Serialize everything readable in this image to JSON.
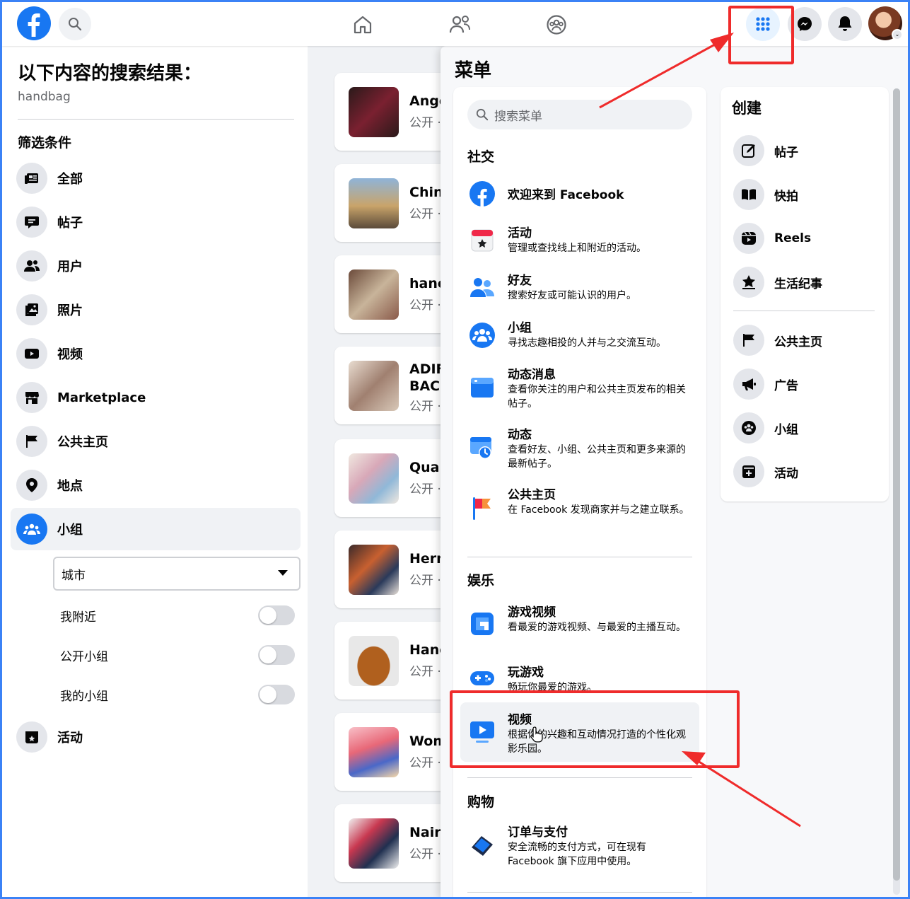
{
  "topbar": {
    "logo": "facebook-logo",
    "icons": [
      "home-icon",
      "friends-icon",
      "groups-icon"
    ],
    "right_icons": [
      "menu-grid-icon",
      "messenger-icon",
      "notification-bell-icon"
    ]
  },
  "sidebar": {
    "title": "以下内容的搜索结果：",
    "query": "handbag",
    "filters_heading": "筛选条件",
    "items": [
      {
        "label": "全部",
        "icon": "all-results-icon"
      },
      {
        "label": "帖子",
        "icon": "posts-icon"
      },
      {
        "label": "用户",
        "icon": "people-icon"
      },
      {
        "label": "照片",
        "icon": "photos-icon"
      },
      {
        "label": "视频",
        "icon": "video-icon"
      },
      {
        "label": "Marketplace",
        "icon": "marketplace-icon"
      },
      {
        "label": "公共主页",
        "icon": "flag-icon"
      },
      {
        "label": "地点",
        "icon": "location-icon"
      },
      {
        "label": "小组",
        "icon": "groups-icon"
      }
    ],
    "city_select": {
      "value": "城市"
    },
    "toggles": [
      {
        "label": "我附近",
        "on": false
      },
      {
        "label": "公开小组",
        "on": false
      },
      {
        "label": "我的小组",
        "on": false
      }
    ],
    "events": {
      "label": "活动",
      "icon": "calendar-icon"
    }
  },
  "results": [
    {
      "title": "Ange",
      "sub": "公开 ·"
    },
    {
      "title": "Chin",
      "sub": "公开 ·"
    },
    {
      "title": "hanc",
      "sub": "公开 ·"
    },
    {
      "title": "ADIF",
      "title2": "BACI",
      "sub": "公开 ·"
    },
    {
      "title": "Qual",
      "sub": "公开 ·"
    },
    {
      "title": "Herm",
      "sub": "公开 ·"
    },
    {
      "title": "Hanc",
      "sub": "公开 ·"
    },
    {
      "title": "Wom",
      "sub": "公开 ·"
    },
    {
      "title": "Nairc",
      "sub": "公开 ·"
    }
  ],
  "menu": {
    "title": "菜单",
    "search_placeholder": "搜索菜单",
    "social": {
      "heading": "社交",
      "items": [
        {
          "title": "欢迎来到 Facebook",
          "desc": ""
        },
        {
          "title": "活动",
          "desc": "管理或查找线上和附近的活动。"
        },
        {
          "title": "好友",
          "desc": "搜索好友或可能认识的用户。"
        },
        {
          "title": "小组",
          "desc": "寻找志趣相投的人并与之交流互动。"
        },
        {
          "title": "动态消息",
          "desc": "查看你关注的用户和公共主页发布的相关帖子。"
        },
        {
          "title": "动态",
          "desc": "查看好友、小组、公共主页和更多来源的最新帖子。"
        },
        {
          "title": "公共主页",
          "desc": "在 Facebook 发现商家并与之建立联系。"
        }
      ]
    },
    "entertainment": {
      "heading": "娱乐",
      "items": [
        {
          "title": "游戏视频",
          "desc": "看最爱的游戏视频、与最爱的主播互动。"
        },
        {
          "title": "玩游戏",
          "desc": "畅玩你最爱的游戏。"
        },
        {
          "title": "视频",
          "desc": "根据你的兴趣和互动情况打造的个性化观影乐园。"
        }
      ]
    },
    "shopping": {
      "heading": "购物",
      "items": [
        {
          "title": "订单与支付",
          "desc": "安全流畅的支付方式，可在现有 Facebook 旗下应用中使用。"
        }
      ]
    },
    "create": {
      "heading": "创建",
      "items": [
        {
          "label": "帖子",
          "icon": "compose-icon"
        },
        {
          "label": "快拍",
          "icon": "book-icon"
        },
        {
          "label": "Reels",
          "icon": "reels-icon"
        },
        {
          "label": "生活纪事",
          "icon": "star-icon"
        },
        {
          "label": "公共主页",
          "icon": "flag-icon"
        },
        {
          "label": "广告",
          "icon": "megaphone-icon"
        },
        {
          "label": "小组",
          "icon": "groups-icon"
        },
        {
          "label": "活动",
          "icon": "calendar-plus-icon"
        }
      ]
    }
  },
  "colors": {
    "brand": "#1877f2",
    "annotation": "#ef2b2b"
  }
}
